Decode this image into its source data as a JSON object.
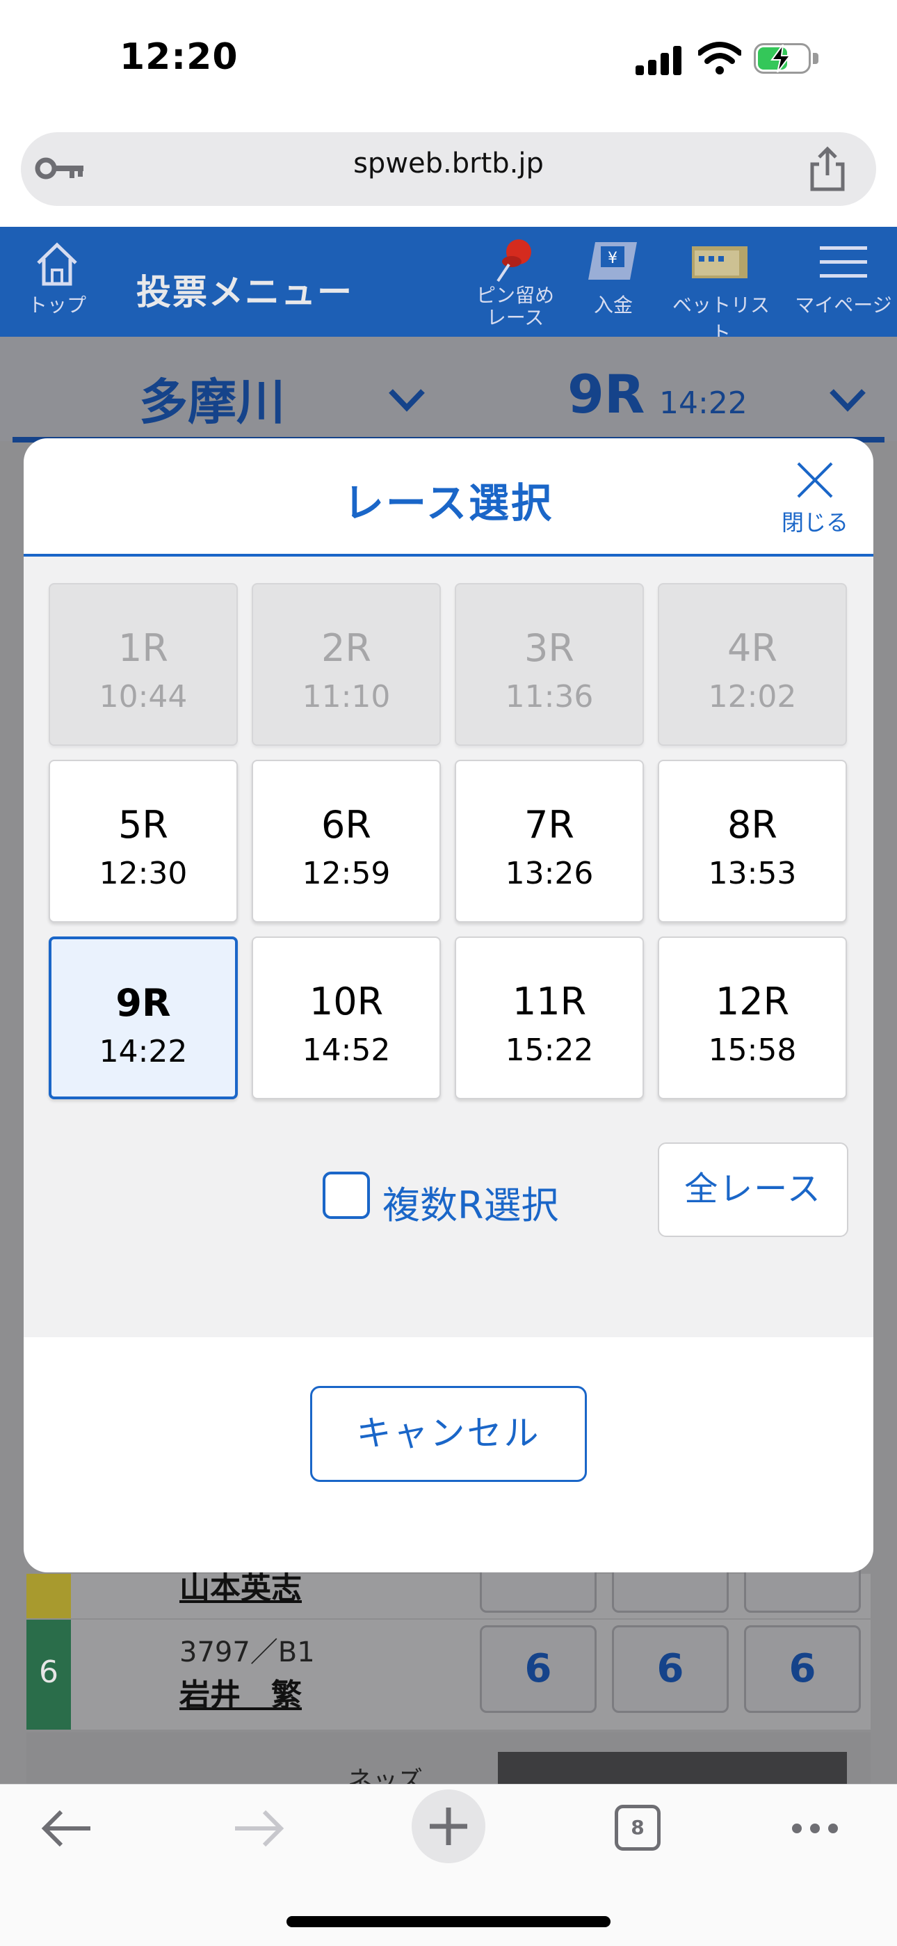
{
  "status_bar": {
    "time": "12:20"
  },
  "browser": {
    "url": "spweb.brtb.jp",
    "tab_count": "8"
  },
  "site_header": {
    "home_label": "トップ",
    "title": "投票メニュー",
    "pin_label_1": "ピン留め",
    "pin_label_2": "レース",
    "deposit_label": "入金",
    "betlist_label": "ベットリスト",
    "mypage_label": "マイページ"
  },
  "race_bar": {
    "venue": "多摩川",
    "race": "9R",
    "race_time": "14:22"
  },
  "modal": {
    "title": "レース選択",
    "close_label": "閉じる",
    "races": [
      {
        "name": "1R",
        "time": "10:44",
        "state": "past"
      },
      {
        "name": "2R",
        "time": "11:10",
        "state": "past"
      },
      {
        "name": "3R",
        "time": "11:36",
        "state": "past"
      },
      {
        "name": "4R",
        "time": "12:02",
        "state": "past"
      },
      {
        "name": "5R",
        "time": "12:30",
        "state": "open"
      },
      {
        "name": "6R",
        "time": "12:59",
        "state": "open"
      },
      {
        "name": "7R",
        "time": "13:26",
        "state": "open"
      },
      {
        "name": "8R",
        "time": "13:53",
        "state": "open"
      },
      {
        "name": "9R",
        "time": "14:22",
        "state": "selected"
      },
      {
        "name": "10R",
        "time": "14:52",
        "state": "open"
      },
      {
        "name": "11R",
        "time": "15:22",
        "state": "open"
      },
      {
        "name": "12R",
        "time": "15:58",
        "state": "open"
      }
    ],
    "multi_select_label": "複数R選択",
    "all_races_label": "全レース",
    "cancel_label": "キャンセル"
  },
  "background_rows": {
    "racer5_name": "山本英志",
    "racer6_id": "3797／B1",
    "racer6_name": "岩井　繁",
    "lane6": "6",
    "odds6": [
      "6",
      "6",
      "6"
    ],
    "partial_label": "ネッズ"
  },
  "colors": {
    "accent": "#1a66c8",
    "header": "#1d5fb5",
    "overlay": "#8e8e90"
  }
}
